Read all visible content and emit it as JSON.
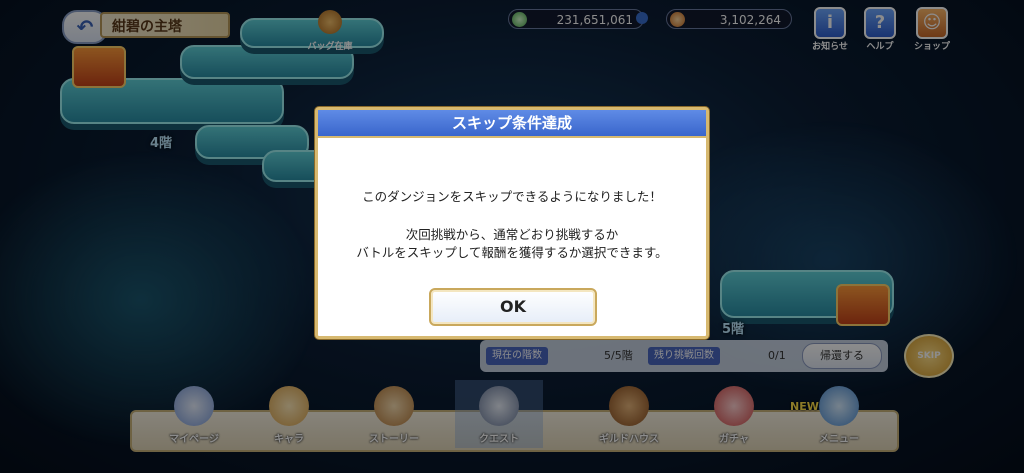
{
  "header": {
    "back_icon": "back-arrow-icon",
    "dungeon_title": "紺碧の主塔",
    "bag_label": "バッグ在庫"
  },
  "currency": {
    "mana": "231,651,061",
    "coins": "3,102,264"
  },
  "top_icons": [
    {
      "label": "お知らせ",
      "icon": "info-icon"
    },
    {
      "label": "ヘルプ",
      "icon": "help-icon"
    },
    {
      "label": "ショップ",
      "icon": "shop-icon"
    }
  ],
  "map": {
    "floor_upper": "4階",
    "floor_current": "5階"
  },
  "info_panel": {
    "current_floor_tag": "現在の階数",
    "current_floor_value": "5/5階",
    "remaining_tag": "残り挑戦回数",
    "remaining_value": "0/1",
    "retreat_label": "帰還する",
    "skip_label": "SKIP"
  },
  "dialog": {
    "title": "スキップ条件達成",
    "line1": "このダンジョンをスキップできるようになりました！",
    "line2": "次回挑戦から、通常どおり挑戦するか",
    "line3": "バトルをスキップして報酬を獲得するか選択できます。",
    "ok_label": "OK"
  },
  "bottom_nav": [
    {
      "label": "マイページ"
    },
    {
      "label": "キャラ"
    },
    {
      "label": "ストーリー"
    },
    {
      "label": "クエスト"
    },
    {
      "label": "ギルドハウス"
    },
    {
      "label": "ガチャ"
    },
    {
      "label": "メニュー"
    }
  ],
  "new_badge": "NEW",
  "colors": {
    "dialog_header": "#3a66cc",
    "dialog_border": "#d7b970",
    "nav_bg": "#e0d5b8"
  }
}
